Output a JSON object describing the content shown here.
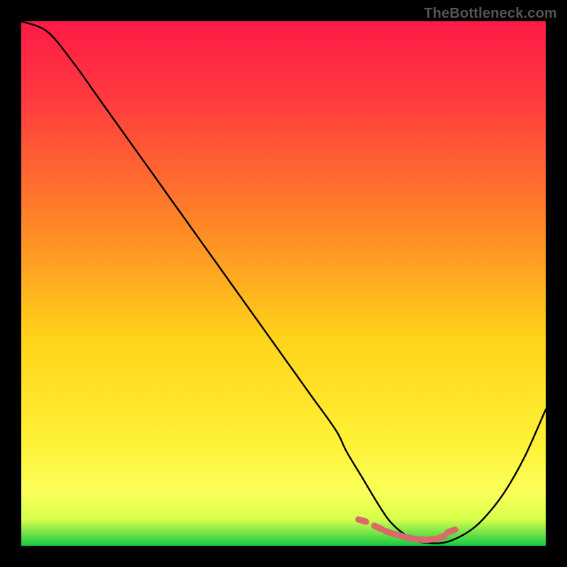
{
  "watermark": "TheBottleneck.com",
  "chart_data": {
    "type": "line",
    "title": "",
    "xlabel": "",
    "ylabel": "",
    "xlim": [
      0,
      100
    ],
    "ylim": [
      0,
      100
    ],
    "annotations": [],
    "gradient_stops": [
      {
        "offset": 0.0,
        "color": "#ff1a46"
      },
      {
        "offset": 0.15,
        "color": "#ff3b3f"
      },
      {
        "offset": 0.4,
        "color": "#ff8a26"
      },
      {
        "offset": 0.6,
        "color": "#ffd21a"
      },
      {
        "offset": 0.8,
        "color": "#fff136"
      },
      {
        "offset": 0.9,
        "color": "#fbff5a"
      },
      {
        "offset": 0.95,
        "color": "#d6ff4a"
      },
      {
        "offset": 1.0,
        "color": "#18c944"
      }
    ],
    "series": [
      {
        "name": "bottleneck-curve",
        "x": [
          0,
          5,
          10,
          15,
          20,
          25,
          30,
          35,
          40,
          45,
          50,
          55,
          60,
          62,
          65,
          68,
          70,
          72,
          75,
          78,
          80,
          82,
          85,
          88,
          92,
          96,
          100
        ],
        "values": [
          100,
          98,
          92,
          85,
          78,
          71,
          64,
          57,
          50,
          43,
          36,
          29,
          22,
          18,
          13,
          8,
          5,
          3,
          1,
          0.5,
          0.5,
          1,
          2.5,
          5,
          10,
          17,
          26
        ]
      }
    ],
    "markers": {
      "name": "highlight-band",
      "color": "#d86a6a",
      "x": [
        65,
        68,
        70,
        72,
        74,
        76,
        78,
        80,
        82
      ],
      "values": [
        4.8,
        3.5,
        2.6,
        2.0,
        1.5,
        1.2,
        1.2,
        1.6,
        2.8
      ],
      "shape": "dash"
    }
  }
}
